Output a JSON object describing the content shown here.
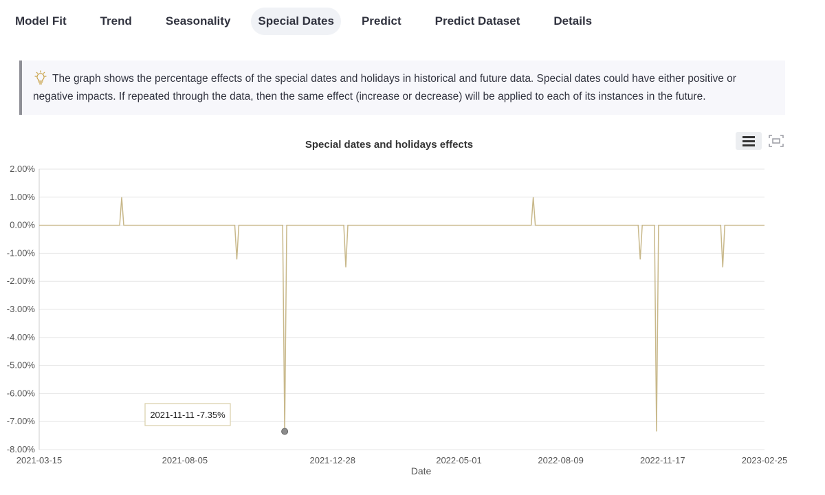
{
  "tabs": [
    {
      "label": "Model Fit",
      "active": false
    },
    {
      "label": "Trend",
      "active": false
    },
    {
      "label": "Seasonality",
      "active": false
    },
    {
      "label": "Special Dates",
      "active": true
    },
    {
      "label": "Predict",
      "active": false
    },
    {
      "label": "Predict Dataset",
      "active": false
    },
    {
      "label": "Details",
      "active": false
    }
  ],
  "info": {
    "icon": "lightbulb-icon",
    "text": "The graph shows the percentage effects of the special dates and holidays in historical and future data. Special dates could have either positive or negative impacts. If repeated through the data, then the same effect (increase or decrease) will be applied to each of its instances in the future."
  },
  "toolbar": {
    "menu_icon": "hamburger-menu-icon",
    "fullscreen_icon": "fullscreen-icon"
  },
  "chart_data": {
    "type": "line",
    "title": "Special dates and holidays effects",
    "xlabel": "Date",
    "ylabel": "",
    "x_ticks": [
      "2021-03-15",
      "2021-08-05",
      "2021-12-28",
      "2022-05-01",
      "2022-08-09",
      "2022-11-17",
      "2023-02-25"
    ],
    "y_ticks": [
      "2.00%",
      "1.00%",
      "0.00%",
      "-1.00%",
      "-2.00%",
      "-3.00%",
      "-4.00%",
      "-5.00%",
      "-6.00%",
      "-7.00%",
      "-8.00%"
    ],
    "ylim": [
      -8,
      2
    ],
    "xlim": [
      "2021-03-15",
      "2023-02-25"
    ],
    "grid": true,
    "line_color": "#c8b88a",
    "points": [
      {
        "x": "2021-03-15",
        "y": 0
      },
      {
        "x": "2021-06-02",
        "y": 0
      },
      {
        "x": "2021-06-04",
        "y": 1.0
      },
      {
        "x": "2021-06-06",
        "y": 0
      },
      {
        "x": "2021-09-23",
        "y": 0
      },
      {
        "x": "2021-09-25",
        "y": -1.22
      },
      {
        "x": "2021-09-27",
        "y": 0
      },
      {
        "x": "2021-11-09",
        "y": 0
      },
      {
        "x": "2021-11-11",
        "y": -7.35
      },
      {
        "x": "2021-11-13",
        "y": 0
      },
      {
        "x": "2022-01-08",
        "y": 0
      },
      {
        "x": "2022-01-10",
        "y": -1.5
      },
      {
        "x": "2022-01-12",
        "y": 0
      },
      {
        "x": "2022-07-11",
        "y": 0
      },
      {
        "x": "2022-07-13",
        "y": 1.0
      },
      {
        "x": "2022-07-15",
        "y": 0
      },
      {
        "x": "2022-10-24",
        "y": 0
      },
      {
        "x": "2022-10-26",
        "y": -1.22
      },
      {
        "x": "2022-10-28",
        "y": 0
      },
      {
        "x": "2022-11-09",
        "y": 0
      },
      {
        "x": "2022-11-11",
        "y": -7.35
      },
      {
        "x": "2022-11-13",
        "y": 0
      },
      {
        "x": "2023-01-13",
        "y": 0
      },
      {
        "x": "2023-01-15",
        "y": -1.5
      },
      {
        "x": "2023-01-17",
        "y": 0
      },
      {
        "x": "2023-02-25",
        "y": 0
      }
    ],
    "tooltip": {
      "text": "2021-11-11 -7.35%",
      "x": "2021-11-11",
      "y": -7.35
    }
  }
}
